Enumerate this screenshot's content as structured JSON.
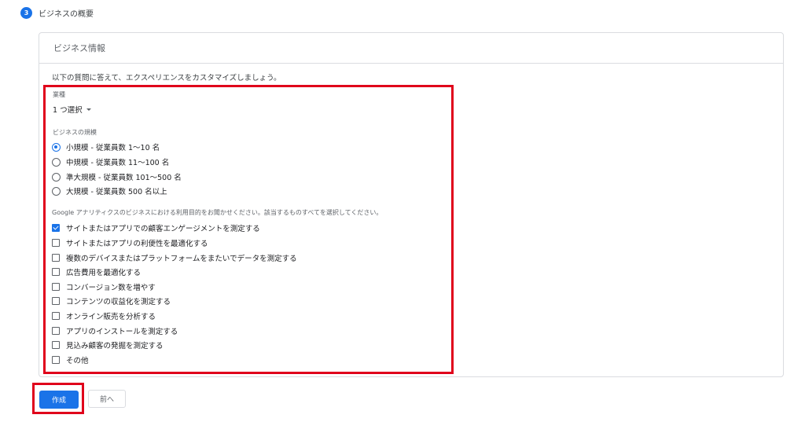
{
  "step": {
    "number": "3",
    "title": "ビジネスの概要"
  },
  "card": {
    "title": "ビジネス情報",
    "intro": "以下の質問に答えて、エクスペリエンスをカスタマイズしましょう。"
  },
  "industry": {
    "label": "業種",
    "value": "1 つ選択"
  },
  "size": {
    "label": "ビジネスの規模",
    "options": [
      {
        "label": "小規模 - 従業員数 1～10 名",
        "selected": true
      },
      {
        "label": "中規模 - 従業員数 11～100 名",
        "selected": false
      },
      {
        "label": "準大規模 - 従業員数 101～500 名",
        "selected": false
      },
      {
        "label": "大規模 - 従業員数 500 名以上",
        "selected": false
      }
    ]
  },
  "purpose": {
    "label": "Google アナリティクスのビジネスにおける利用目的をお聞かせください。該当するものすべてを選択してください。",
    "options": [
      {
        "label": "サイトまたはアプリでの顧客エンゲージメントを測定する",
        "checked": true
      },
      {
        "label": "サイトまたはアプリの利便性を最適化する",
        "checked": false
      },
      {
        "label": "複数のデバイスまたはプラットフォームをまたいでデータを測定する",
        "checked": false
      },
      {
        "label": "広告費用を最適化する",
        "checked": false
      },
      {
        "label": "コンバージョン数を増やす",
        "checked": false
      },
      {
        "label": "コンテンツの収益化を測定する",
        "checked": false
      },
      {
        "label": "オンライン販売を分析する",
        "checked": false
      },
      {
        "label": "アプリのインストールを測定する",
        "checked": false
      },
      {
        "label": "見込み顧客の発掘を測定する",
        "checked": false
      },
      {
        "label": "その他",
        "checked": false
      }
    ]
  },
  "buttons": {
    "create": "作成",
    "back": "前へ"
  },
  "colors": {
    "accent": "#1a73e8",
    "highlight": "#e0001b"
  }
}
